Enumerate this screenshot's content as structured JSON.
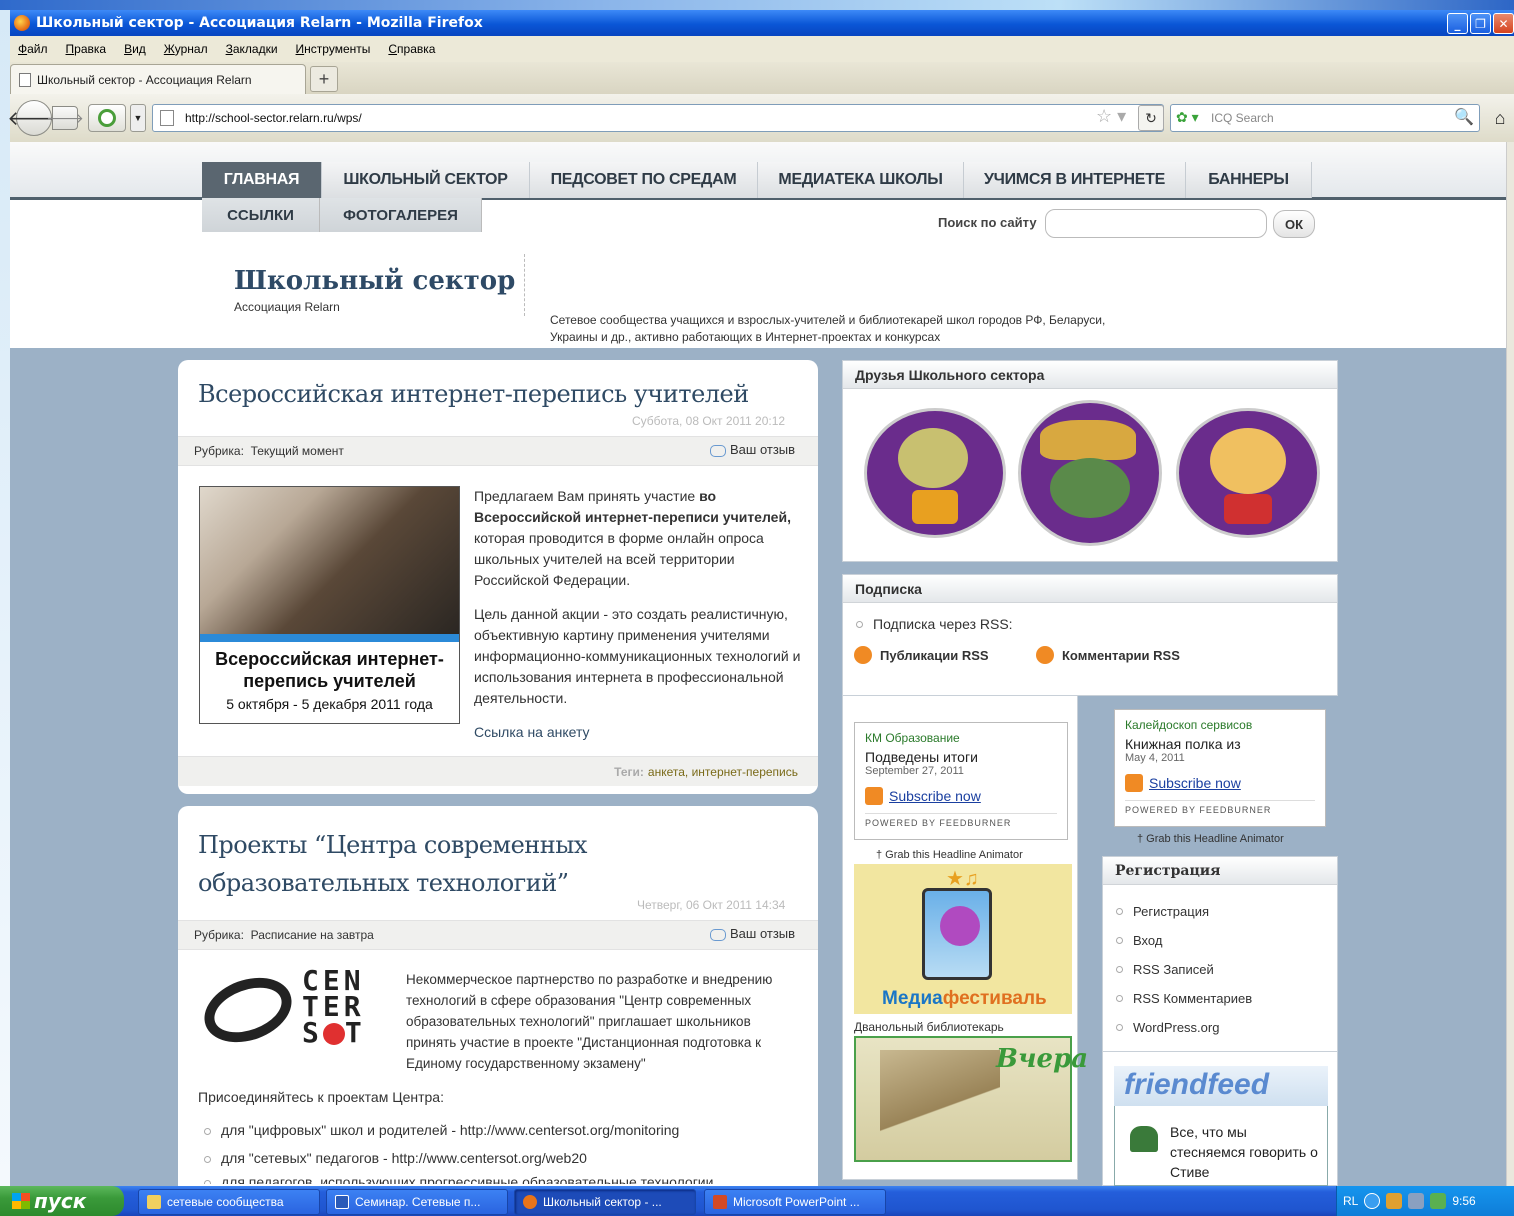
{
  "window": {
    "title": "Школьный сектор - Ассоциация Relarn - Mozilla Firefox"
  },
  "menu": [
    "Файл",
    "Правка",
    "Вид",
    "Журнал",
    "Закладки",
    "Инструменты",
    "Справка"
  ],
  "tab": {
    "label": "Школьный сектор - Ассоциация Relarn",
    "new_tab": "+"
  },
  "nav": {
    "url": "http://school-sector.relarn.ru/wps/",
    "search_placeholder": "ICQ Search"
  },
  "site": {
    "nav1": [
      "ГЛАВНАЯ",
      "ШКОЛЬНЫЙ СЕКТОР",
      "ПЕДСОВЕТ ПО СРЕДАМ",
      "МЕДИАТЕКА ШКОЛЫ",
      "УЧИМСЯ В ИНТЕРНЕТЕ",
      "БАННЕРЫ"
    ],
    "nav2": [
      "ССЫЛКИ",
      "ФОТОГАЛЕРЕЯ"
    ],
    "search_label": "Поиск по сайту",
    "search_button": "ОК",
    "logo": "Школьный сектор",
    "logo_sub": "Ассоциация Relarn",
    "tagline": "Сетевое сообщества учащихся и взрослых-учителей и библиотекарей школ городов РФ, Беларуси, Украины и др., активно работающих в Интернет-проектах и конкурсах"
  },
  "post1": {
    "title": "Всероссийская интернет-перепись учителей",
    "date": "Суббота, 08 Окт 2011 20:12",
    "rubric_label": "Рубрика:",
    "rubric": "Текущий момент",
    "reply": "Ваш отзыв",
    "p1_plain": "Предлагаем Вам принять участие ",
    "p1_bold": "во Всероссийской интернет-переписи учителей,",
    "p1_rest": " которая проводится в форме онлайн опроса школьных учителей на всей территории Российской Федерации.",
    "p2": "Цель данной акции - это создать реалистичную, объективную картину применения учителями информационно-коммуникационных технологий и использования интернета в профессиональной деятельности.",
    "link": "Ссылка на анкету",
    "tags_label": "Теги:",
    "tags": "анкета, интернет-перепись",
    "image_title": "Всероссийская интернет-перепись учителей",
    "image_dates": "5 октября - 5 декабря 2011 года"
  },
  "post2": {
    "title": "Проекты “Центра современных образовательных технологий”",
    "date": "Четверг, 06 Окт 2011 14:34",
    "rubric_label": "Рубрика:",
    "rubric": "Расписание на завтра",
    "reply": "Ваш отзыв",
    "logo_lines": [
      "CEN",
      "TER",
      "S",
      "T"
    ],
    "p1": "Некоммерческое партнерство по разработке и внедрению технологий в сфере образования \"Центр современных образовательных технологий\" приглашает школьников принять участие в проекте \"Дистанционная подготовка к Единому государственному экзамену\"",
    "join": "Присоединяйтесь к проектам Центра:",
    "items": [
      "для \"цифровых\" школ и родителей - http://www.centersot.org/monitoring",
      "для \"сетевых\" педагогов - http://www.centersot.org/web20",
      "для педагогов, использующих прогрессивные образовательные технологии"
    ]
  },
  "sidebar": {
    "friends_title": "Друзья Школьного сектора",
    "sub_title": "Подписка",
    "sub_rss": "Подписка через RSS:",
    "pub_rss": "Публикации RSS",
    "comm_rss": "Комментарии RSS",
    "fb1": {
      "source": "КМ Образование",
      "headline": "Подведены итоги",
      "date": "September 27, 2011",
      "subscribe": "Subscribe now",
      "powered": "POWERED BY FEEDBURNER",
      "grab": "† Grab this Headline Animator"
    },
    "fb2": {
      "source": "Калейдоскоп сервисов",
      "headline": "Книжная полка из",
      "date": "May 4, 2011",
      "subscribe": "Subscribe now",
      "powered": "POWERED BY FEEDBURNER",
      "grab": "† Grab this Headline Animator"
    },
    "mediafest_a": "Медиа",
    "mediafest_b": "фестиваль",
    "dvanon": "Дванольный библиотекарь",
    "vchera": "Вчера",
    "reg_title": "Регистрация",
    "reg_items": [
      "Регистрация",
      "Вход",
      "RSS Записей",
      "RSS Комментариев",
      "WordPress.org"
    ],
    "friendfeed": "friendfeed",
    "ff_text": "Все, что мы стесняемся говорить о Стиве"
  },
  "taskbar": {
    "start": "пуск",
    "items": [
      "сетевые сообщества",
      "Семинар. Сетевые п...",
      "Школьный сектор - ...",
      "Microsoft PowerPoint ..."
    ],
    "lang": "RL",
    "clock": "9:56"
  },
  "colors": {
    "accent": "#2f4a64",
    "xp_blue": "#245edb",
    "rss": "#f08a24"
  }
}
